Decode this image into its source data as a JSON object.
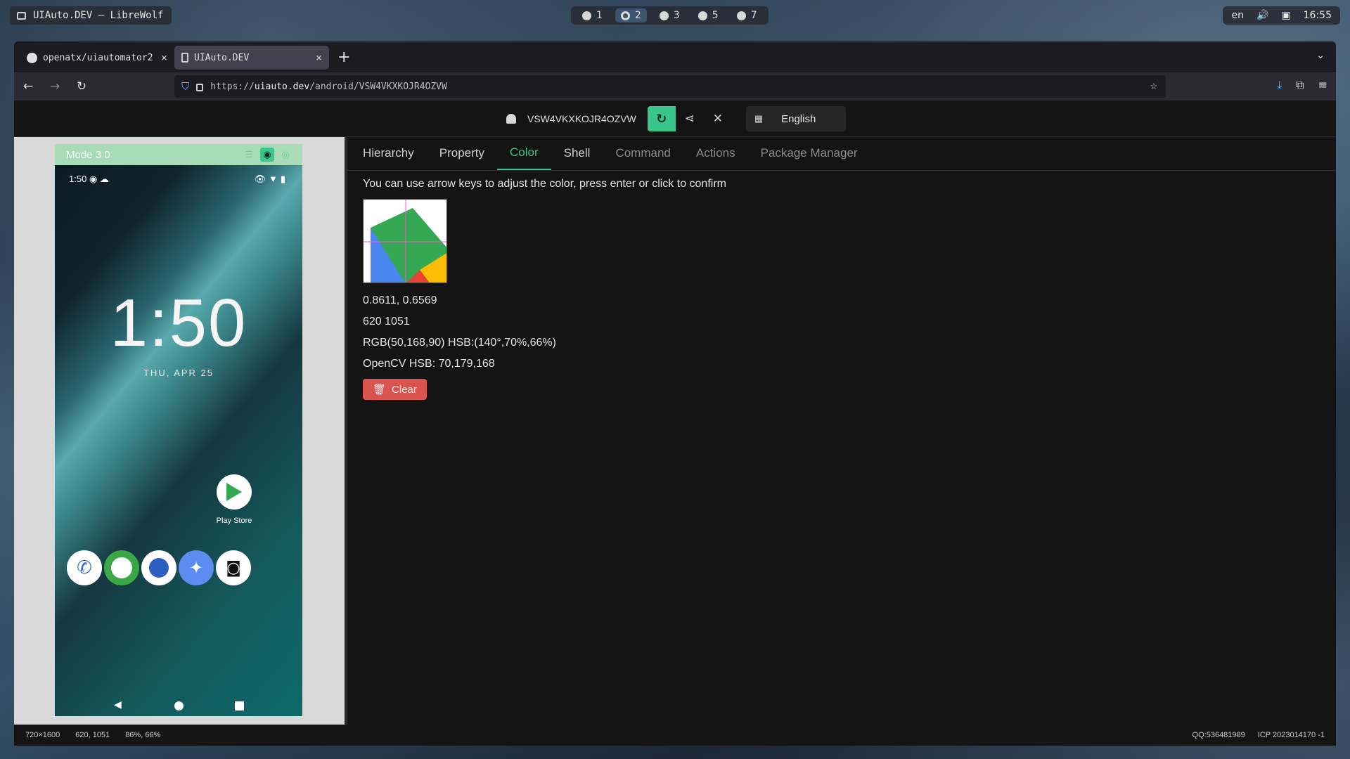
{
  "desktop": {
    "window_title": "UIAuto.DEV — LibreWolf",
    "workspaces": [
      "1",
      "2",
      "3",
      "5",
      "7"
    ],
    "active_workspace": "2",
    "lang": "en",
    "time": "16:55"
  },
  "browser": {
    "tabs": [
      {
        "label": "openatx/uiautomator2",
        "close": "×"
      },
      {
        "label": "UIAuto.DEV",
        "close": "×"
      }
    ],
    "new_tab": "+",
    "url_scheme": "https://",
    "url_host": "uiauto.dev",
    "url_path": "/android/VSW4VKXKOJR4OZVW"
  },
  "devbar": {
    "serial": "VSW4VKXKOJR4OZVW",
    "language": "English"
  },
  "phone": {
    "mode": "Mode 3 0",
    "status_time": "1:50",
    "clock": "1:50",
    "date": "THU, APR 25",
    "play_store_label": "Play Store"
  },
  "tabs": [
    "Hierarchy",
    "Property",
    "Color",
    "Shell",
    "Command",
    "Actions",
    "Package Manager"
  ],
  "active_tab": "Color",
  "color_panel": {
    "hint": "You can use arrow keys to adjust the color, press enter or click to confirm",
    "ratio": "0.8611, 0.6569",
    "coords": "620 1051",
    "rgb_hsb": "RGB(50,168,90) HSB:(140°,70%,66%)",
    "opencv": "OpenCV HSB: 70,179,168",
    "clear_label": "Clear"
  },
  "footer": {
    "resolution": "720×1600",
    "position": "620, 1051",
    "percent": "86%, 66%",
    "qq": "QQ:536481989",
    "icp": "ICP 2023014170 -1"
  }
}
